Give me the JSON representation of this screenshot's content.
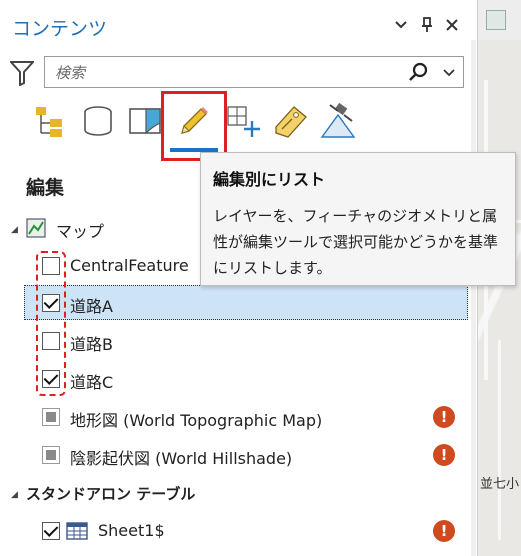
{
  "panel": {
    "title": "コンテンツ",
    "controls": {
      "dropdown_icon": "chevron-down",
      "pin_icon": "pin",
      "close_icon": "close"
    }
  },
  "search": {
    "placeholder": "検索"
  },
  "toolbar": {
    "tools": [
      "list-by-drawing-order",
      "list-by-data-source",
      "list-by-selection",
      "list-by-editing",
      "list-by-snapping",
      "list-by-labeling",
      "list-by-perspective-imagery"
    ],
    "active": "list-by-editing"
  },
  "section": {
    "heading": "編集"
  },
  "tree": {
    "map": {
      "label": "マップ"
    },
    "layers": [
      {
        "label": "CentralFeature",
        "checked": false
      },
      {
        "label": "道路A",
        "checked": true,
        "selected": true
      },
      {
        "label": "道路B",
        "checked": false
      },
      {
        "label": "道路C",
        "checked": true
      }
    ],
    "basemaps": [
      {
        "label": "地形図 (World Topographic Map)",
        "warning": "!"
      },
      {
        "label": "陰影起伏図 (World Hillshade)",
        "warning": "!"
      }
    ],
    "standalone": {
      "label": "スタンドアロン テーブル"
    },
    "tables": [
      {
        "label": "Sheet1$",
        "checked": true,
        "warning": "!"
      }
    ]
  },
  "tooltip": {
    "title": "編集別にリスト",
    "body": "レイヤーを、フィーチャのジオメトリと属性が編集ツールで選択可能かどうかを基準にリストします。"
  },
  "map_view": {
    "label": "並七小"
  },
  "colors": {
    "title": "#1f6fb6",
    "highlight": "#e02020",
    "selection": "#cde3f6",
    "active_tool": "#1a73c9",
    "warning": "#cf4a1e"
  }
}
